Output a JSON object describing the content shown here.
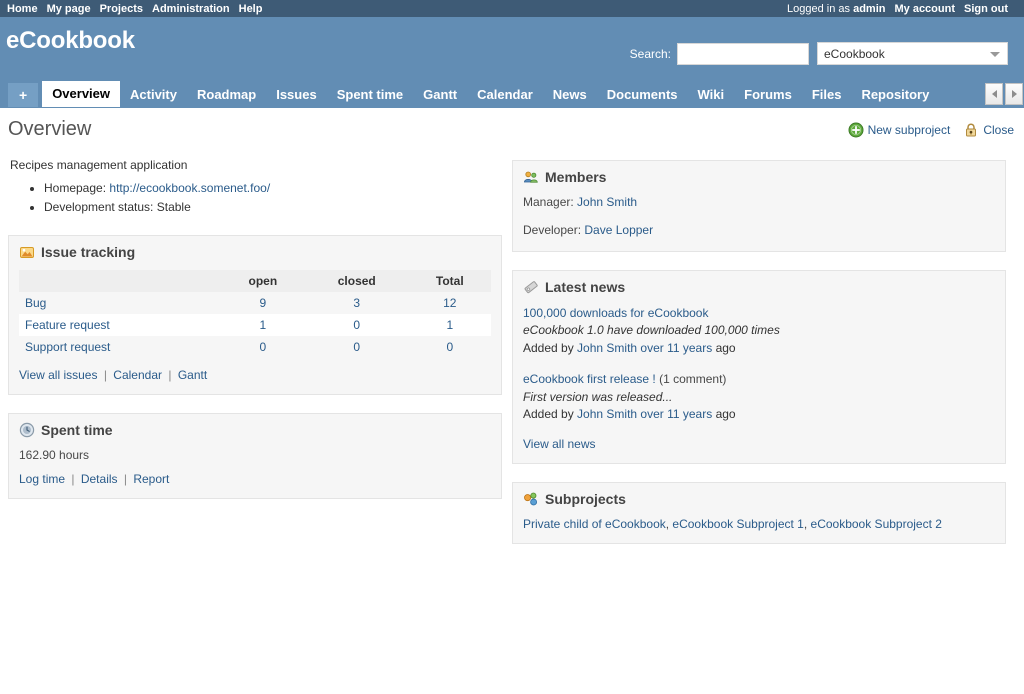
{
  "top_menu": {
    "items": [
      {
        "label": "Home",
        "name": "top-menu-home"
      },
      {
        "label": "My page",
        "name": "top-menu-my-page"
      },
      {
        "label": "Projects",
        "name": "top-menu-projects"
      },
      {
        "label": "Administration",
        "name": "top-menu-administration"
      },
      {
        "label": "Help",
        "name": "top-menu-help"
      }
    ],
    "logged_in_prefix": "Logged in as ",
    "logged_in_user": "admin",
    "my_account": "My account",
    "sign_out": "Sign out"
  },
  "header": {
    "app_title": "eCookbook",
    "search_label": "Search:",
    "search_value": "",
    "search_placeholder": "",
    "project_scope": "eCookbook"
  },
  "tabs": {
    "new_object_label": "+",
    "items": [
      {
        "label": "Overview",
        "selected": true
      },
      {
        "label": "Activity",
        "selected": false
      },
      {
        "label": "Roadmap",
        "selected": false
      },
      {
        "label": "Issues",
        "selected": false
      },
      {
        "label": "Spent time",
        "selected": false
      },
      {
        "label": "Gantt",
        "selected": false
      },
      {
        "label": "Calendar",
        "selected": false
      },
      {
        "label": "News",
        "selected": false
      },
      {
        "label": "Documents",
        "selected": false
      },
      {
        "label": "Wiki",
        "selected": false
      },
      {
        "label": "Forums",
        "selected": false
      },
      {
        "label": "Files",
        "selected": false
      },
      {
        "label": "Repository",
        "selected": false
      }
    ]
  },
  "page": {
    "title": "Overview",
    "contextual": {
      "new_subproject": "New subproject",
      "close": "Close"
    }
  },
  "project": {
    "description": "Recipes management application",
    "meta": [
      {
        "label": "Homepage:",
        "value": "http://ecookbook.somenet.foo/",
        "is_link": true
      },
      {
        "label": "Development status:",
        "value": "Stable",
        "is_link": false
      }
    ]
  },
  "issue_tracking": {
    "title": "Issue tracking",
    "columns": [
      "",
      "open",
      "closed",
      "Total"
    ],
    "rows": [
      {
        "tracker": "Bug",
        "open": "9",
        "closed": "3",
        "total": "12"
      },
      {
        "tracker": "Feature request",
        "open": "1",
        "closed": "0",
        "total": "1"
      },
      {
        "tracker": "Support request",
        "open": "0",
        "closed": "0",
        "total": "0"
      }
    ],
    "links": [
      "View all issues",
      "Calendar",
      "Gantt"
    ]
  },
  "spent_time": {
    "title": "Spent time",
    "hours": "162.90 hours",
    "links": [
      "Log time",
      "Details",
      "Report"
    ]
  },
  "members": {
    "title": "Members",
    "roles": [
      {
        "role": "Manager:",
        "people": "John Smith"
      },
      {
        "role": "Developer:",
        "people": "Dave Lopper"
      }
    ]
  },
  "latest_news": {
    "title": "Latest news",
    "items": [
      {
        "title": "100,000 downloads for eCookbook",
        "comments": "",
        "summary": "eCookbook 1.0 have downloaded 100,000 times",
        "added_by_prefix": "Added by ",
        "author": "John Smith",
        "when": " over 11 years ",
        "ago": "ago"
      },
      {
        "title": "eCookbook first release !",
        "comments": " (1 comment)",
        "summary": "First version was released...",
        "added_by_prefix": "Added by ",
        "author": "John Smith",
        "when": " over 11 years ",
        "ago": "ago"
      }
    ],
    "view_all": "View all news"
  },
  "subprojects": {
    "title": "Subprojects",
    "items": [
      "Private child of eCookbook",
      "eCookbook Subproject 1",
      "eCookbook Subproject 2"
    ],
    "separator": ", "
  },
  "colors": {
    "header_blue": "#628db4",
    "top_bar_blue": "#3e5b76",
    "link_blue": "#2a5b8a",
    "box_bg": "#f6f6f6"
  }
}
